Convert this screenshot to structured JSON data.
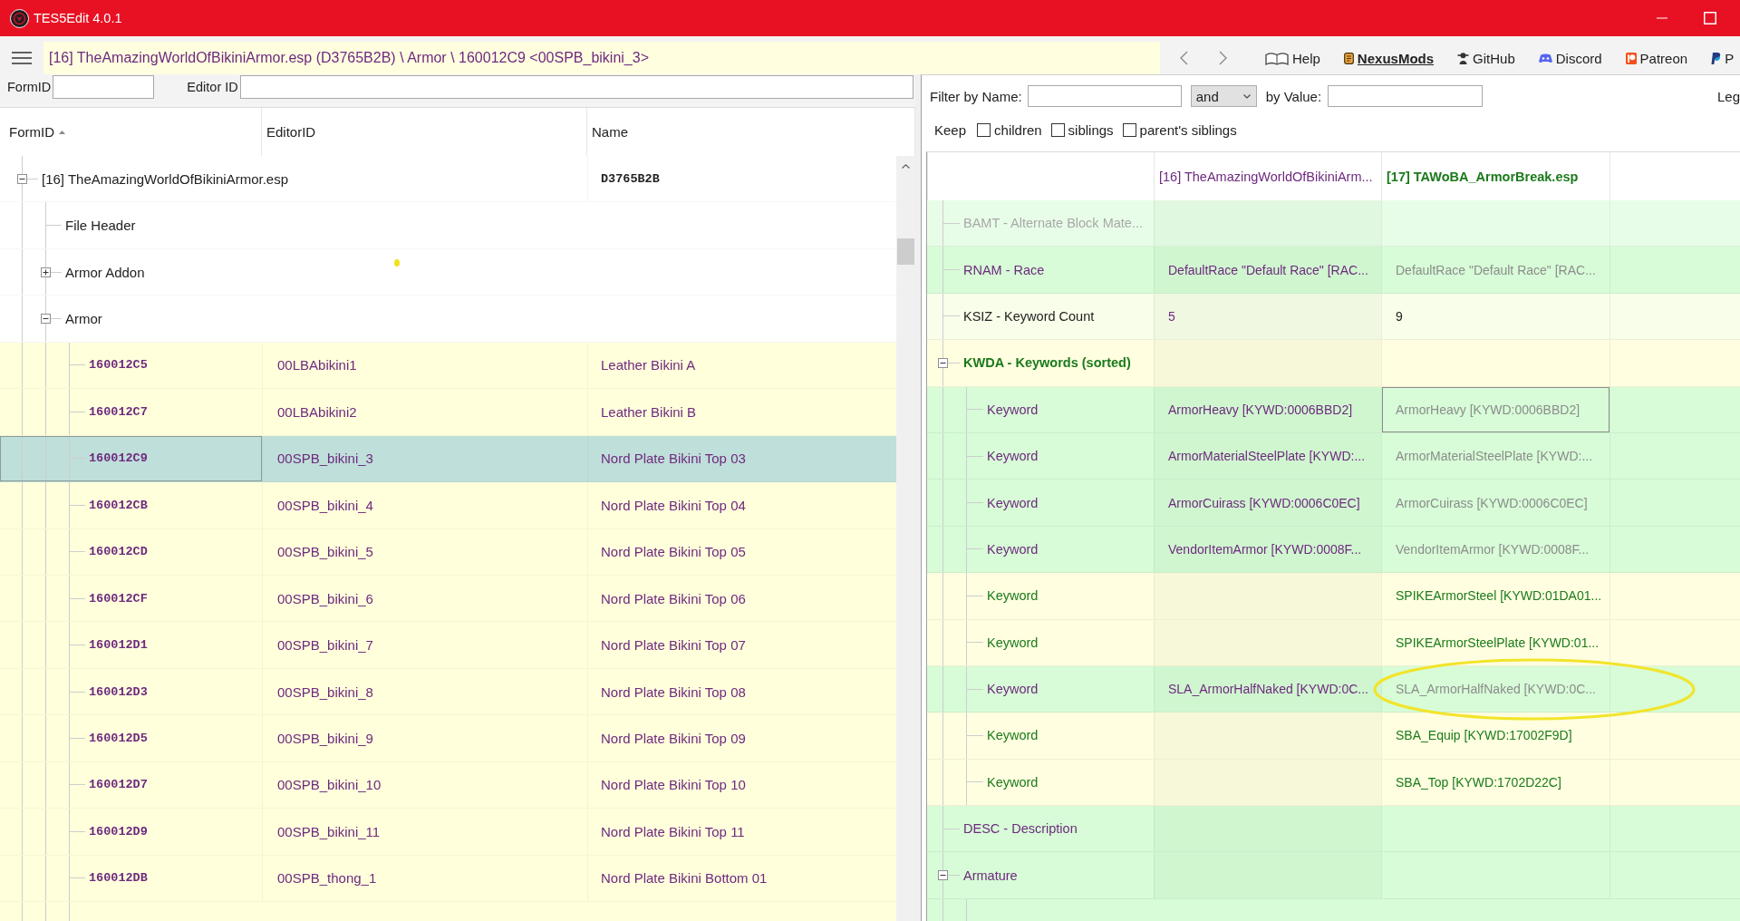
{
  "window": {
    "title": "TES5Edit 4.0.1"
  },
  "toolbar": {
    "path": "[16] TheAmazingWorldOfBikiniArmor.esp (D3765B2B) \\ Armor \\ 160012C9 <00SPB_bikini_3>",
    "links": [
      {
        "kind": "book",
        "label": "Help",
        "highlighted": false
      },
      {
        "kind": "nexus",
        "label": "NexusMods",
        "highlighted": true
      },
      {
        "kind": "github",
        "label": "GitHub",
        "highlighted": false
      },
      {
        "kind": "discord",
        "label": "Discord",
        "highlighted": false
      },
      {
        "kind": "patreon",
        "label": "Patreon",
        "highlighted": false
      },
      {
        "kind": "paypal",
        "label": "P",
        "highlighted": false
      }
    ]
  },
  "search": {
    "formid_label": "FormID",
    "editorid_label": "Editor ID"
  },
  "tree": {
    "columns": [
      {
        "label": "FormID",
        "sorted": true
      },
      {
        "label": "EditorID",
        "sorted": false
      },
      {
        "label": "Name",
        "sorted": false
      }
    ],
    "nodes": [
      {
        "kind": "file",
        "label": "[16] TheAmazingWorldOfBikiniArmor.esp",
        "name": "D3765B2B",
        "expanded": true,
        "children": [
          {
            "kind": "group",
            "label": "File Header"
          },
          {
            "kind": "group",
            "label": "Armor Addon",
            "expanded": false
          },
          {
            "kind": "group",
            "label": "Armor",
            "expanded": true,
            "children": [
              {
                "kind": "record",
                "form_id": "160012C5",
                "editor_id": "00LBAbikini1",
                "name": "Leather Bikini A",
                "selected": false
              },
              {
                "kind": "record",
                "form_id": "160012C7",
                "editor_id": "00LBAbikini2",
                "name": "Leather Bikini B",
                "selected": false
              },
              {
                "kind": "record",
                "form_id": "160012C9",
                "editor_id": "00SPB_bikini_3",
                "name": "Nord Plate Bikini Top 03",
                "selected": true
              },
              {
                "kind": "record",
                "form_id": "160012CB",
                "editor_id": "00SPB_bikini_4",
                "name": "Nord Plate Bikini Top 04",
                "selected": false
              },
              {
                "kind": "record",
                "form_id": "160012CD",
                "editor_id": "00SPB_bikini_5",
                "name": "Nord Plate Bikini Top 05",
                "selected": false
              },
              {
                "kind": "record",
                "form_id": "160012CF",
                "editor_id": "00SPB_bikini_6",
                "name": "Nord Plate Bikini Top 06",
                "selected": false
              },
              {
                "kind": "record",
                "form_id": "160012D1",
                "editor_id": "00SPB_bikini_7",
                "name": "Nord Plate Bikini Top 07",
                "selected": false
              },
              {
                "kind": "record",
                "form_id": "160012D3",
                "editor_id": "00SPB_bikini_8",
                "name": "Nord Plate Bikini Top 08",
                "selected": false
              },
              {
                "kind": "record",
                "form_id": "160012D5",
                "editor_id": "00SPB_bikini_9",
                "name": "Nord Plate Bikini Top 09",
                "selected": false
              },
              {
                "kind": "record",
                "form_id": "160012D7",
                "editor_id": "00SPB_bikini_10",
                "name": "Nord Plate Bikini Top 10",
                "selected": false
              },
              {
                "kind": "record",
                "form_id": "160012D9",
                "editor_id": "00SPB_bikini_11",
                "name": "Nord Plate Bikini Top 11",
                "selected": false
              },
              {
                "kind": "record",
                "form_id": "160012DB",
                "editor_id": "00SPB_thong_1",
                "name": "Nord Plate Bikini Bottom 01",
                "selected": false
              }
            ]
          }
        ]
      }
    ]
  },
  "filter": {
    "name_label": "Filter by Name:",
    "operator": "and",
    "value_label": "by Value:",
    "legend": "Leg",
    "keep_label": "Keep",
    "keep_options": [
      {
        "label": "children",
        "checked": false
      },
      {
        "label": "siblings",
        "checked": false
      },
      {
        "label": "parent's siblings",
        "checked": false
      }
    ]
  },
  "record_view": {
    "columns": [
      {
        "label": "[16] TheAmazingWorldOfBikiniArm...",
        "color": "#6e2a7e",
        "emphasized": false
      },
      {
        "label": "[17] TAWoBA_ArmorBreak.esp",
        "color": "#1b7a1b",
        "emphasized": true
      }
    ],
    "rows": [
      {
        "field": {
          "text": "BAMT - Alternate Block Mate...",
          "color": "#a8a8a8",
          "emphasized": false
        },
        "color": "#e8fde8"
      },
      {
        "field": {
          "text": "RNAM - Race",
          "color": "#6e2a7e",
          "emphasized": false
        },
        "color": "#d7fcd7",
        "column_2": {
          "text": "DefaultRace \"Default Race\" [RAC...",
          "color": "#6e2a7e",
          "selected": false
        },
        "column_3": {
          "text": "DefaultRace \"Default Race\" [RAC...",
          "color": "#8c8c8c",
          "selected": false
        }
      },
      {
        "field": {
          "text": "KSIZ - Keyword Count",
          "color": "#222222",
          "emphasized": false
        },
        "color": "#f8fee9",
        "column_2": {
          "text": "5",
          "color": "#6e2a7e",
          "selected": false
        },
        "column_3": {
          "text": "9",
          "color": "#222222",
          "selected": false
        }
      },
      {
        "field": {
          "text": "KWDA - Keywords (sorted)",
          "color": "#1b7a1b",
          "emphasized": true
        },
        "color": "#fffee0",
        "expanded": true,
        "children": [
          {
            "field": {
              "text": "Keyword",
              "color": "#6e2a7e",
              "emphasized": false
            },
            "color": "#d7fcd7",
            "column_2": {
              "text": "ArmorHeavy [KYWD:0006BBD2]",
              "color": "#6e2a7e",
              "selected": false
            },
            "column_3": {
              "text": "ArmorHeavy [KYWD:0006BBD2]",
              "color": "#8c8c8c",
              "selected": true
            }
          },
          {
            "field": {
              "text": "Keyword",
              "color": "#6e2a7e",
              "emphasized": false
            },
            "color": "#d7fcd7",
            "column_2": {
              "text": "ArmorMaterialSteelPlate [KYWD:...",
              "color": "#6e2a7e",
              "selected": false
            },
            "column_3": {
              "text": "ArmorMaterialSteelPlate [KYWD:...",
              "color": "#8c8c8c",
              "selected": false
            }
          },
          {
            "field": {
              "text": "Keyword",
              "color": "#6e2a7e",
              "emphasized": false
            },
            "color": "#d7fcd7",
            "column_2": {
              "text": "ArmorCuirass [KYWD:0006C0EC]",
              "color": "#6e2a7e",
              "selected": false
            },
            "column_3": {
              "text": "ArmorCuirass [KYWD:0006C0EC]",
              "color": "#8c8c8c",
              "selected": false
            }
          },
          {
            "field": {
              "text": "Keyword",
              "color": "#6e2a7e",
              "emphasized": false
            },
            "color": "#d7fcd7",
            "column_2": {
              "text": "VendorItemArmor [KYWD:0008F...",
              "color": "#6e2a7e",
              "selected": false
            },
            "column_3": {
              "text": "VendorItemArmor [KYWD:0008F...",
              "color": "#8c8c8c",
              "selected": false
            }
          },
          {
            "field": {
              "text": "Keyword",
              "color": "#1b7a1b",
              "emphasized": false
            },
            "color": "#fffee0",
            "column_3": {
              "text": "SPIKEArmorSteel [KYWD:01DA01...",
              "color": "#1b7a1b",
              "selected": false
            }
          },
          {
            "field": {
              "text": "Keyword",
              "color": "#1b7a1b",
              "emphasized": false
            },
            "color": "#fffee0",
            "column_3": {
              "text": "SPIKEArmorSteelPlate [KYWD:01...",
              "color": "#1b7a1b",
              "selected": false
            }
          },
          {
            "field": {
              "text": "Keyword",
              "color": "#6e2a7e",
              "emphasized": false
            },
            "color": "#d7fcd7",
            "column_2": {
              "text": "SLA_ArmorHalfNaked [KYWD:0C...",
              "color": "#6e2a7e",
              "selected": false
            },
            "column_3": {
              "text": "SLA_ArmorHalfNaked [KYWD:0C...",
              "color": "#8c8c8c",
              "selected": false
            }
          },
          {
            "field": {
              "text": "Keyword",
              "color": "#1b7a1b",
              "emphasized": false
            },
            "color": "#fffee0",
            "column_3": {
              "text": "SBA_Equip [KYWD:17002F9D]",
              "color": "#1b7a1b",
              "selected": false
            }
          },
          {
            "field": {
              "text": "Keyword",
              "color": "#1b7a1b",
              "emphasized": false
            },
            "color": "#fffee0",
            "column_3": {
              "text": "SBA_Top [KYWD:1702D22C]",
              "color": "#1b7a1b",
              "selected": false
            }
          }
        ]
      },
      {
        "field": {
          "text": "DESC - Description",
          "color": "#6e2a7e",
          "emphasized": false
        },
        "color": "#d7fcd7"
      },
      {
        "field": {
          "text": "Armature",
          "color": "#6e2a7e",
          "emphasized": false
        },
        "color": "#d7fcd7",
        "expanded": true
      }
    ]
  }
}
